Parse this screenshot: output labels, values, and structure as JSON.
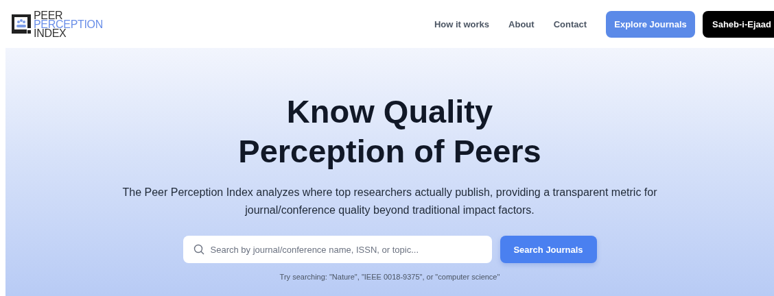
{
  "logo": {
    "lines": [
      "PEER",
      "PERCEPTION",
      "INDEX"
    ]
  },
  "nav": {
    "links": [
      "How it works",
      "About",
      "Contact"
    ],
    "primary_button": "Explore Journals",
    "user_button": "Saheb-i-Ejaad"
  },
  "hero": {
    "title_lines": [
      "Know Quality",
      "Perception of Peers"
    ],
    "subtitle": "The Peer Perception Index analyzes where top researchers actually publish, providing a transparent metric for journal/conference quality beyond traditional impact factors.",
    "search": {
      "placeholder": "Search by journal/conference name, ISSN, or topic..."
    },
    "search_button": "Search Journals",
    "hint": "Try searching: \"Nature\", \"IEEE 0018-9375\", or \"computer science\""
  }
}
